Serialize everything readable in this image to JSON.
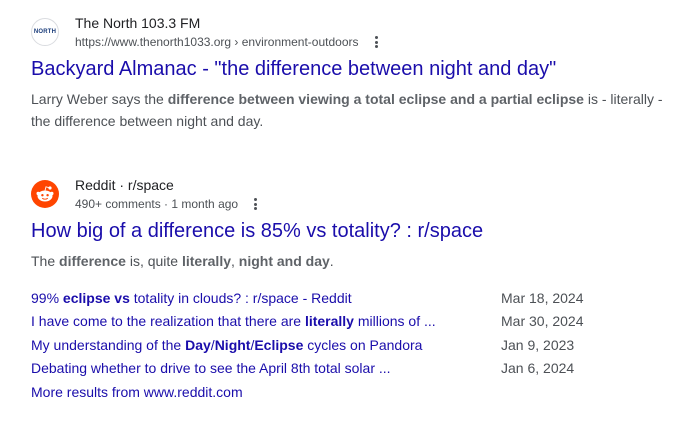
{
  "result1": {
    "favicon_text": "NORTH",
    "site_name": "The North 103.3 FM",
    "url": "https://www.thenorth1033.org › environment-outdoors",
    "title": "Backyard Almanac - \"the difference between night and day\"",
    "snippet": [
      {
        "text": "Larry Weber says the ",
        "bold": false
      },
      {
        "text": "difference between viewing a total eclipse and a partial eclipse",
        "bold": true
      },
      {
        "text": " is - literally - the difference between night and day.",
        "bold": false
      }
    ]
  },
  "result2": {
    "site_name": "Reddit · r/space",
    "meta": "490+ comments · 1 month ago",
    "title": "How big of a difference is 85% vs totality? : r/space",
    "snippet": [
      {
        "text": "The ",
        "bold": false
      },
      {
        "text": "difference",
        "bold": true
      },
      {
        "text": " is, quite ",
        "bold": false
      },
      {
        "text": "literally",
        "bold": true
      },
      {
        "text": ", ",
        "bold": false
      },
      {
        "text": "night and day",
        "bold": true
      },
      {
        "text": ".",
        "bold": false
      }
    ],
    "sublinks": [
      {
        "parts": [
          {
            "text": "99% ",
            "bold": false
          },
          {
            "text": "eclipse vs",
            "bold": true
          },
          {
            "text": " totality in clouds? : r/space - Reddit",
            "bold": false
          }
        ],
        "date": "Mar 18, 2024"
      },
      {
        "parts": [
          {
            "text": "I have come to the realization that there are ",
            "bold": false
          },
          {
            "text": "literally",
            "bold": true
          },
          {
            "text": " millions of ...",
            "bold": false
          }
        ],
        "date": "Mar 30, 2024"
      },
      {
        "parts": [
          {
            "text": "My understanding of the ",
            "bold": false
          },
          {
            "text": "Day",
            "bold": true
          },
          {
            "text": "/",
            "bold": false
          },
          {
            "text": "Night",
            "bold": true
          },
          {
            "text": "/",
            "bold": false
          },
          {
            "text": "Eclipse",
            "bold": true
          },
          {
            "text": " cycles on Pandora",
            "bold": false
          }
        ],
        "date": "Jan 9, 2023"
      },
      {
        "parts": [
          {
            "text": "Debating whether to drive to see the April 8th total solar ...",
            "bold": false
          }
        ],
        "date": "Jan 6, 2024"
      }
    ],
    "more_results": "More results from www.reddit.com"
  },
  "colors": {
    "link": "#1a0dab",
    "reddit": "#ff4500",
    "text": "#4d5156"
  },
  "icons": {
    "result1": "the-north-logo",
    "result2": "reddit-snoo-icon",
    "menu": "more-vert-icon"
  }
}
